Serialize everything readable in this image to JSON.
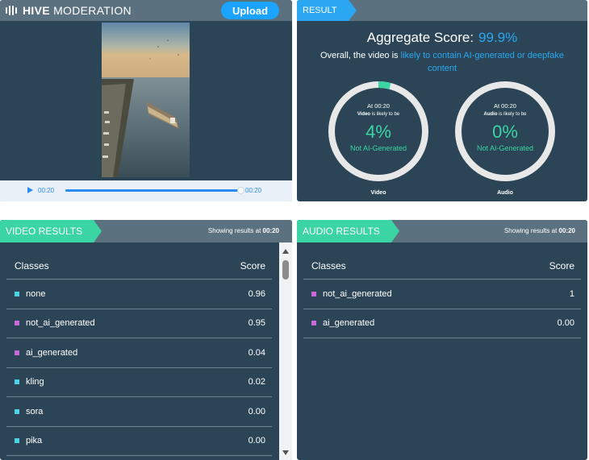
{
  "header": {
    "brand_bold": "HIVE",
    "brand_light": "MODERATION",
    "upload_label": "Upload"
  },
  "player": {
    "current_time": "00:20",
    "end_time": "00:20",
    "progress_fraction": 0.98
  },
  "result": {
    "tag": "RESULT",
    "aggregate_label": "Aggregate Score:",
    "aggregate_value": "99.9%",
    "overall_prefix": "Overall, the video is",
    "overall_highlight": "likely to contain AI-generated or deepfake content",
    "gauges": [
      {
        "at": "At 00:20",
        "subject": "Video",
        "likely": "is likely to be",
        "percent": "4%",
        "fraction": 0.04,
        "status": "Not AI-Generated",
        "caption": "Video"
      },
      {
        "at": "At 00:20",
        "subject": "Audio",
        "likely": "is likely to be",
        "percent": "0%",
        "fraction": 0.0,
        "status": "Not AI-Generated",
        "caption": "Audio"
      }
    ]
  },
  "video_results": {
    "tag": "VIDEO RESULTS",
    "showing_prefix": "Showing results at",
    "showing_time": "00:20",
    "col_classes": "Classes",
    "col_score": "Score",
    "rows": [
      {
        "name": "none",
        "score": "0.96",
        "color": "#4fd1e6"
      },
      {
        "name": "not_ai_generated",
        "score": "0.95",
        "color": "#c86bd9"
      },
      {
        "name": "ai_generated",
        "score": "0.04",
        "color": "#c86bd9"
      },
      {
        "name": "kling",
        "score": "0.02",
        "color": "#4fd1e6"
      },
      {
        "name": "sora",
        "score": "0.00",
        "color": "#4fd1e6"
      },
      {
        "name": "pika",
        "score": "0.00",
        "color": "#4fd1e6"
      }
    ]
  },
  "audio_results": {
    "tag": "AUDIO RESULTS",
    "showing_prefix": "Showing results at",
    "showing_time": "00:20",
    "col_classes": "Classes",
    "col_score": "Score",
    "rows": [
      {
        "name": "not_ai_generated",
        "score": "1",
        "color": "#c86bd9"
      },
      {
        "name": "ai_generated",
        "score": "0.00",
        "color": "#c86bd9"
      }
    ]
  },
  "colors": {
    "panel": "#2b4556",
    "bar": "#5c7180",
    "accent_blue": "#2aa7f0",
    "accent_green": "#3bd4a3"
  }
}
